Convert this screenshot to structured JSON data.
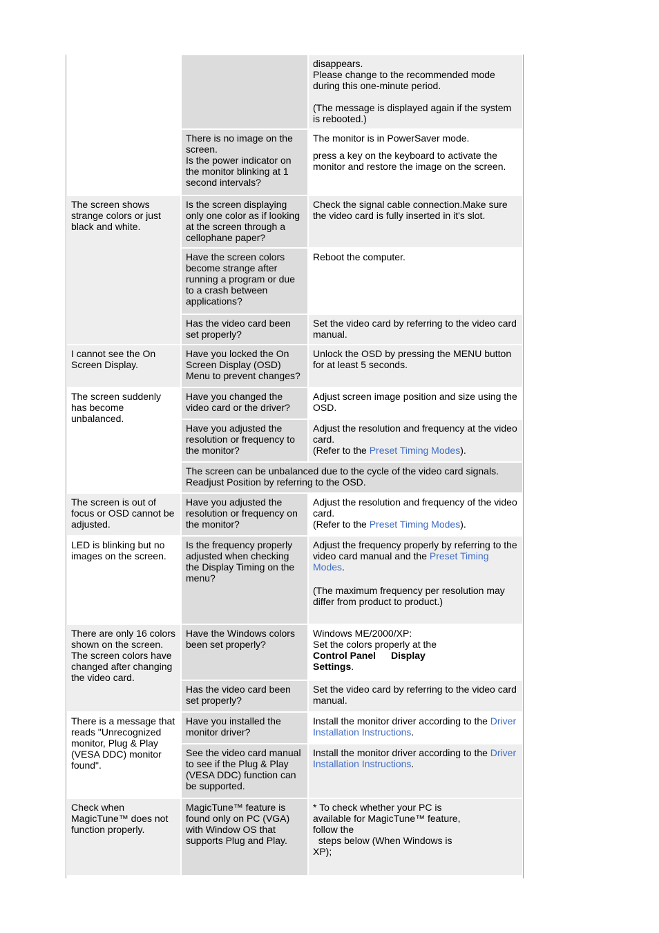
{
  "link_color": "#3f6cc4",
  "rows": {
    "r0": {
      "a1": "disappears.",
      "a2": "Please change to the recommended mode during this one-minute period.",
      "a3": "(The message is displayed again if the system is rebooted.)"
    },
    "r1": {
      "q": [
        "There is no image on the screen.",
        "Is the power indicator on the monitor blinking at 1 second intervals?"
      ],
      "a1": "The monitor is in PowerSaver mode.",
      "a2": "press a key on the keyboard to activate the monitor and restore the image on the screen."
    },
    "g2": {
      "problem": "The screen shows strange colors or just black and white.",
      "s1": {
        "q": "Is the screen displaying only one color as if looking at the screen through a cellophane paper?",
        "a": "Check the signal cable connection.Make sure the video card is fully inserted in it's slot."
      },
      "s2": {
        "q": "Have the screen colors become strange after running a program or due to a crash between applications?",
        "a": "Reboot the computer."
      },
      "s3": {
        "q": "Has the video card been set properly?",
        "a": "Set the video card by referring to the video card manual."
      }
    },
    "g3": {
      "problem": "I cannot see the On Screen Display.",
      "q": "Have you locked the On Screen Display (OSD) Menu to prevent changes?",
      "a": "Unlock the OSD by pressing the MENU button for at least 5 seconds."
    },
    "g4": {
      "problem": "The screen suddenly has become unbalanced.",
      "s1": {
        "q": "Have you changed the video card or the driver?",
        "a": "Adjust screen image position and size using the OSD."
      },
      "s2": {
        "q": "Have you adjusted the resolution or frequency to the monitor?",
        "a1": "Adjust the resolution and frequency at the video card.",
        "a_pre": "(Refer to the ",
        "link": "Preset Timing Modes",
        "a_post": ")."
      },
      "note": [
        "The screen can be unbalanced due to the cycle of the video card signals.",
        "Readjust Position by referring to the OSD."
      ]
    },
    "g5": {
      "problem": "The screen is out of focus or OSD cannot be adjusted.",
      "q": "Have you adjusted the resolution or frequency on the monitor?",
      "a1": "Adjust the resolution and frequency of the video card.",
      "a_pre": "(Refer to the ",
      "link": "Preset Timing Modes",
      "a_post": ")."
    },
    "g6": {
      "problem": "LED is blinking but no images on the screen.",
      "q": "Is the frequency properly adjusted when checking the Display Timing on the menu?",
      "a_pre": "Adjust the frequency properly by referring to the video card manual and the ",
      "link": "Preset Timing Modes",
      "a_post": ".",
      "a2": "(The maximum frequency per resolution may differ from product to product.)"
    },
    "g7": {
      "problem": [
        "There are only 16 colors shown on the screen.",
        "The screen colors have changed after changing the video card."
      ],
      "s1": {
        "q": "Have the Windows colors been set properly?",
        "a1": "Windows ME/2000/XP:",
        "a2": "Set the colors properly at the",
        "b1": "Control Panel",
        "b2": "Display",
        "b3": "Settings",
        "a3": "."
      },
      "s2": {
        "q": "Has the video card been set properly?",
        "a": "Set the video card by referring to the video card manual."
      }
    },
    "g8": {
      "problem": "There is a message that reads \"Unrecognized monitor, Plug & Play (VESA DDC) monitor found\".",
      "s1": {
        "q": "Have you installed the monitor driver?",
        "a_pre": "Install the monitor driver according to the ",
        "link": "Driver Installation Instructions",
        "a_post": "."
      },
      "s2": {
        "q": "See the video card manual to see if the Plug & Play (VESA DDC) function can be supported.",
        "a_pre": "Install the monitor driver according to the ",
        "link": "Driver Installation Instructions",
        "a_post": "."
      }
    },
    "g9": {
      "problem": "Check when MagicTune™ does not function properly.",
      "q": "MagicTune™ feature is found only on PC (VGA) with Window OS that supports Plug and Play.",
      "a": [
        "* To check whether your PC is available for MagicTune™ feature, follow the",
        "  steps below (When Windows is XP);"
      ]
    }
  }
}
